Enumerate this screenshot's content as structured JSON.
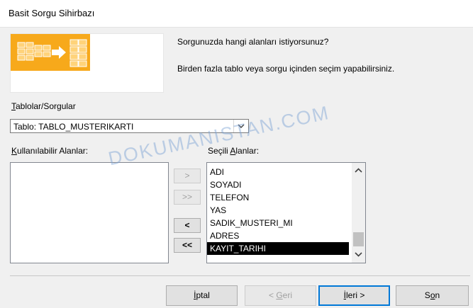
{
  "window": {
    "title": "Basit Sorgu Sihirbazı"
  },
  "intro": {
    "prompt": "Sorgunuzda hangi alanları istiyorsunuz?",
    "hint": "Birden fazla tablo veya sorgu içinden seçim yapabilirsiniz."
  },
  "tables": {
    "label_accel": "T",
    "label_rest": "ablolar/Sorgular",
    "selected": "Tablo: TABLO_MUSTERIKARTI"
  },
  "available": {
    "label_accel": "K",
    "label_rest": "ullanılabilir Alanlar:",
    "items": []
  },
  "selected_fields": {
    "label_pre": "Seçili ",
    "label_accel": "A",
    "label_rest": "lanlar:",
    "items": [
      "ADI",
      "SOYADI",
      "TELEFON",
      "YAS",
      "SADIK_MUSTERI_MI",
      "ADRES",
      "KAYIT_TARIHI"
    ],
    "selected_item": "KAYIT_TARIHI"
  },
  "move_buttons": {
    "add_one": ">",
    "add_all": ">>",
    "remove_one": "<",
    "remove_all": "<<"
  },
  "footer": {
    "cancel_accel": "İ",
    "cancel_rest": "ptal",
    "back_pre": "< ",
    "back_accel": "G",
    "back_rest": "eri",
    "next_accel": "İ",
    "next_rest": "leri >",
    "finish_pre": "S",
    "finish_accel": "o",
    "finish_rest": "n"
  },
  "watermark": "DOKUMANISTAN.COM",
  "colors": {
    "accent": "#0078d7",
    "hero_orange": "#f7a91b",
    "selection": "#000000"
  },
  "icons": {
    "combo_arrow": "chevron-down-icon",
    "scroll_up": "chevron-up-icon",
    "scroll_down": "chevron-down-icon"
  }
}
